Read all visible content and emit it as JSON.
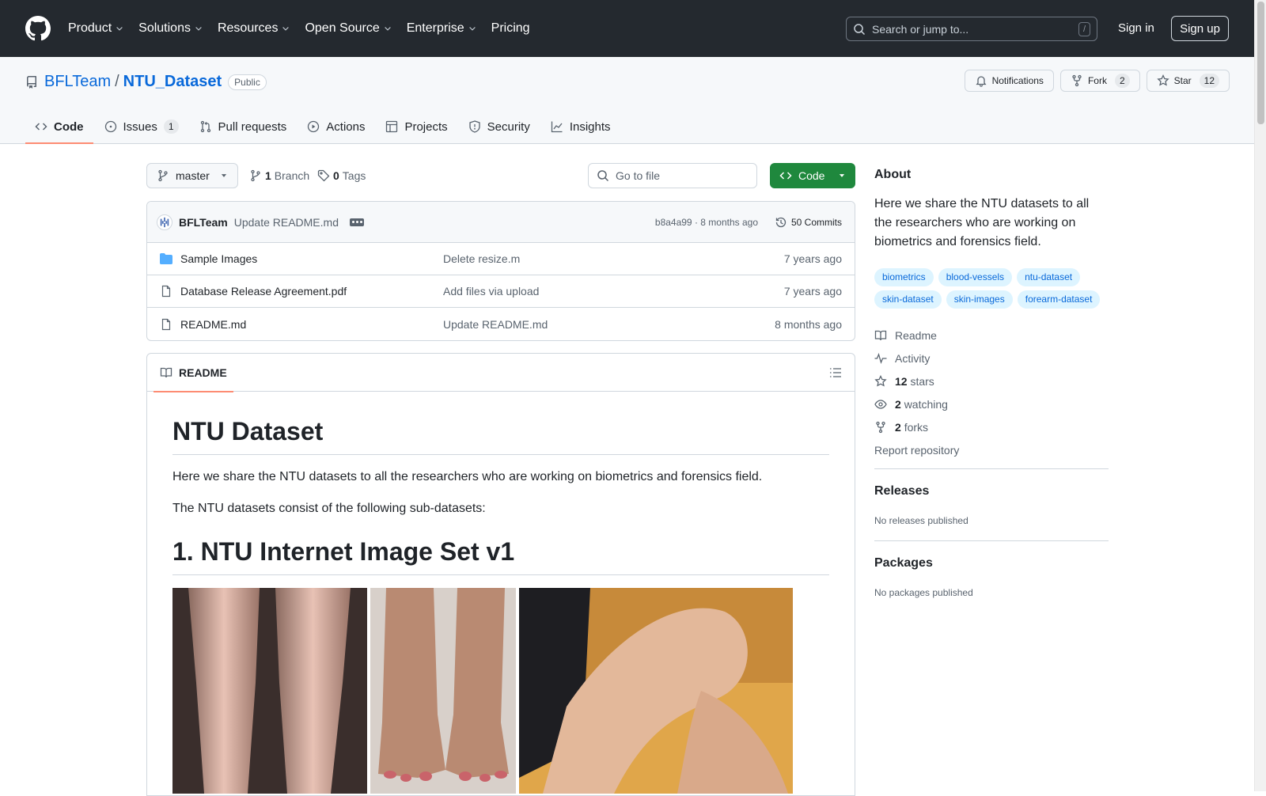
{
  "header": {
    "nav": [
      {
        "label": "Product",
        "dropdown": true
      },
      {
        "label": "Solutions",
        "dropdown": true
      },
      {
        "label": "Resources",
        "dropdown": true
      },
      {
        "label": "Open Source",
        "dropdown": true
      },
      {
        "label": "Enterprise",
        "dropdown": true
      },
      {
        "label": "Pricing",
        "dropdown": false
      }
    ],
    "search_placeholder": "Search or jump to...",
    "search_shortcut": "/",
    "sign_in": "Sign in",
    "sign_up": "Sign up"
  },
  "repo": {
    "owner": "BFLTeam",
    "separator": "/",
    "name": "NTU_Dataset",
    "visibility": "Public",
    "notifications_label": "Notifications",
    "fork_label": "Fork",
    "fork_count": "2",
    "star_label": "Star",
    "star_count": "12",
    "tabs": [
      {
        "label": "Code",
        "count": ""
      },
      {
        "label": "Issues",
        "count": "1"
      },
      {
        "label": "Pull requests",
        "count": ""
      },
      {
        "label": "Actions",
        "count": ""
      },
      {
        "label": "Projects",
        "count": ""
      },
      {
        "label": "Security",
        "count": ""
      },
      {
        "label": "Insights",
        "count": ""
      }
    ]
  },
  "toolbar": {
    "branch": "master",
    "branch_count": "1",
    "branch_label": "Branch",
    "tag_count": "0",
    "tag_label": "Tags",
    "goto_placeholder": "Go to file",
    "code_button": "Code"
  },
  "commit": {
    "author": "BFLTeam",
    "message": "Update README.md",
    "hash_time": "b8a4a99 · 8 months ago",
    "commits_label": "50 Commits"
  },
  "files": [
    {
      "type": "folder",
      "name": "Sample Images",
      "message": "Delete resize.m",
      "age": "7 years ago"
    },
    {
      "type": "file",
      "name": "Database Release Agreement.pdf",
      "message": "Add files via upload",
      "age": "7 years ago"
    },
    {
      "type": "file",
      "name": "README.md",
      "message": "Update README.md",
      "age": "8 months ago"
    }
  ],
  "readme": {
    "tab_label": "README",
    "h1": "NTU Dataset",
    "p1": "Here we share the NTU datasets to all the researchers who are working on biometrics and forensics field.",
    "p2": "The NTU datasets consist of the following sub-datasets:",
    "h2": "1. NTU Internet Image Set v1"
  },
  "about": {
    "title": "About",
    "description": "Here we share the NTU datasets to all the researchers who are working on biometrics and forensics field.",
    "topics": [
      "biometrics",
      "blood-vessels",
      "ntu-dataset",
      "skin-dataset",
      "skin-images",
      "forearm-dataset"
    ],
    "readme": "Readme",
    "activity": "Activity",
    "stars_count": "12",
    "stars_label": "stars",
    "watching_count": "2",
    "watching_label": "watching",
    "forks_count": "2",
    "forks_label": "forks",
    "report": "Report repository"
  },
  "releases": {
    "title": "Releases",
    "empty": "No releases published"
  },
  "packages": {
    "title": "Packages",
    "empty": "No packages published"
  },
  "colors": {
    "header_bg": "#24292f",
    "link": "#0969da",
    "green": "#1f883d",
    "tab_underline": "#fd8c73",
    "topic_bg": "#ddf4ff"
  }
}
